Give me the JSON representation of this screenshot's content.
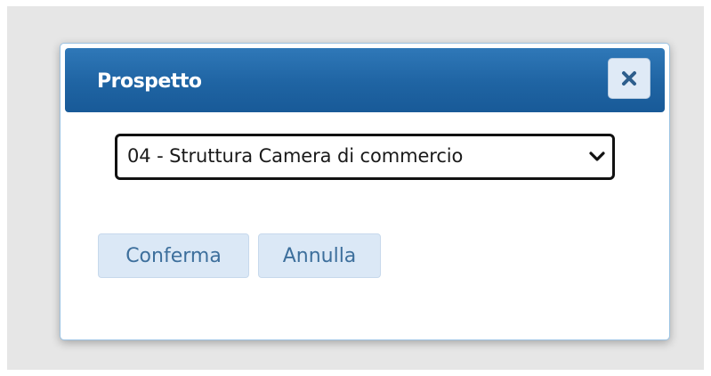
{
  "dialog": {
    "title": "Prospetto",
    "close_icon": "close-icon",
    "select": {
      "selected_value": "04 - Struttura Camera di commercio"
    },
    "buttons": {
      "confirm_label": "Conferma",
      "cancel_label": "Annulla"
    }
  },
  "colors": {
    "titlebar": "#1f64a3",
    "button_bg": "#dbe8f6",
    "button_text": "#3d6f9c",
    "backdrop": "#e6e6e6"
  }
}
